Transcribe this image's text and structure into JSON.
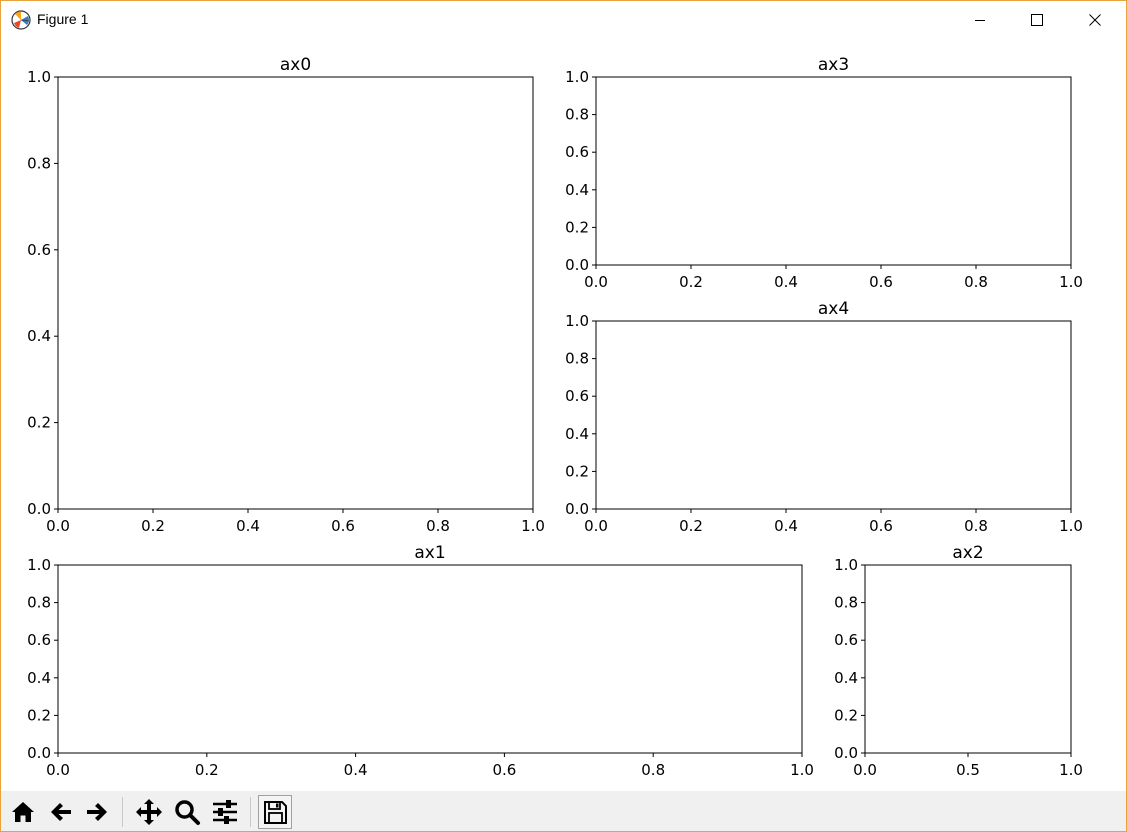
{
  "window": {
    "title": "Figure 1",
    "controls": [
      "minimize-icon",
      "maximize-icon",
      "close-icon"
    ]
  },
  "toolbar": {
    "buttons": [
      "home-icon",
      "back-icon",
      "forward-icon",
      "pan-icon",
      "zoom-icon",
      "configure-subplots-icon",
      "save-icon"
    ]
  },
  "chart_data": [
    {
      "type": "line",
      "title": "ax0",
      "xlim": [
        0,
        1
      ],
      "ylim": [
        0,
        1
      ],
      "xticks": [
        "0.0",
        "0.2",
        "0.4",
        "0.6",
        "0.8",
        "1.0"
      ],
      "yticks": [
        "0.0",
        "0.2",
        "0.4",
        "0.6",
        "0.8",
        "1.0"
      ],
      "series": []
    },
    {
      "type": "line",
      "title": "ax1",
      "xlim": [
        0,
        1
      ],
      "ylim": [
        0,
        1
      ],
      "xticks": [
        "0.0",
        "0.2",
        "0.4",
        "0.6",
        "0.8",
        "1.0"
      ],
      "yticks": [
        "0.0",
        "0.2",
        "0.4",
        "0.6",
        "0.8",
        "1.0"
      ],
      "series": []
    },
    {
      "type": "line",
      "title": "ax2",
      "xlim": [
        0,
        1
      ],
      "ylim": [
        0,
        1
      ],
      "xticks": [
        "0.0",
        "0.5",
        "1.0"
      ],
      "yticks": [
        "0.0",
        "0.2",
        "0.4",
        "0.6",
        "0.8",
        "1.0"
      ],
      "series": []
    },
    {
      "type": "line",
      "title": "ax3",
      "xlim": [
        0,
        1
      ],
      "ylim": [
        0,
        1
      ],
      "xticks": [
        "0.0",
        "0.2",
        "0.4",
        "0.6",
        "0.8",
        "1.0"
      ],
      "yticks": [
        "0.0",
        "0.2",
        "0.4",
        "0.6",
        "0.8",
        "1.0"
      ],
      "series": []
    },
    {
      "type": "line",
      "title": "ax4",
      "xlim": [
        0,
        1
      ],
      "ylim": [
        0,
        1
      ],
      "xticks": [
        "0.0",
        "0.2",
        "0.4",
        "0.6",
        "0.8",
        "1.0"
      ],
      "yticks": [
        "0.0",
        "0.2",
        "0.4",
        "0.6",
        "0.8",
        "1.0"
      ],
      "series": []
    }
  ]
}
